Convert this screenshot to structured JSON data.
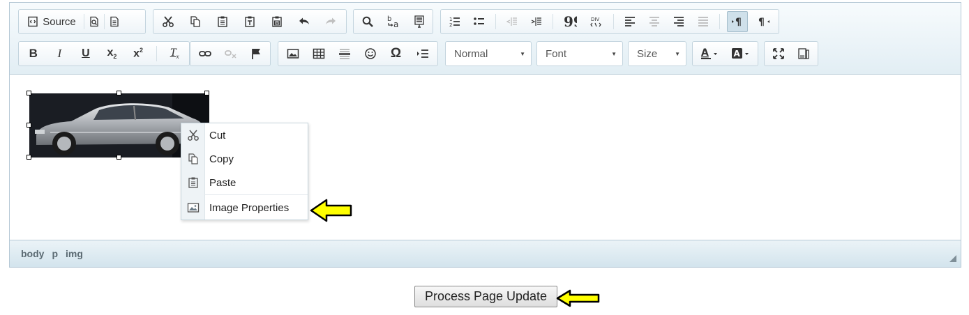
{
  "toolbar": {
    "source_label": "Source",
    "format_combo": "Normal",
    "font_combo": "Font",
    "size_combo": "Size"
  },
  "context_menu": {
    "items": [
      {
        "label": "Cut",
        "icon": "cut-icon"
      },
      {
        "label": "Copy",
        "icon": "copy-icon"
      },
      {
        "label": "Paste",
        "icon": "paste-icon"
      },
      {
        "label": "Image Properties",
        "icon": "image-icon"
      }
    ]
  },
  "statusbar": {
    "path": [
      "body",
      "p",
      "img"
    ]
  },
  "footer": {
    "update_button": "Process Page Update"
  },
  "colors": {
    "annotation_arrow": "#ffff00",
    "toolbar_border": "#b6c9d6",
    "statusbar_bg": "#d3e4ed"
  }
}
